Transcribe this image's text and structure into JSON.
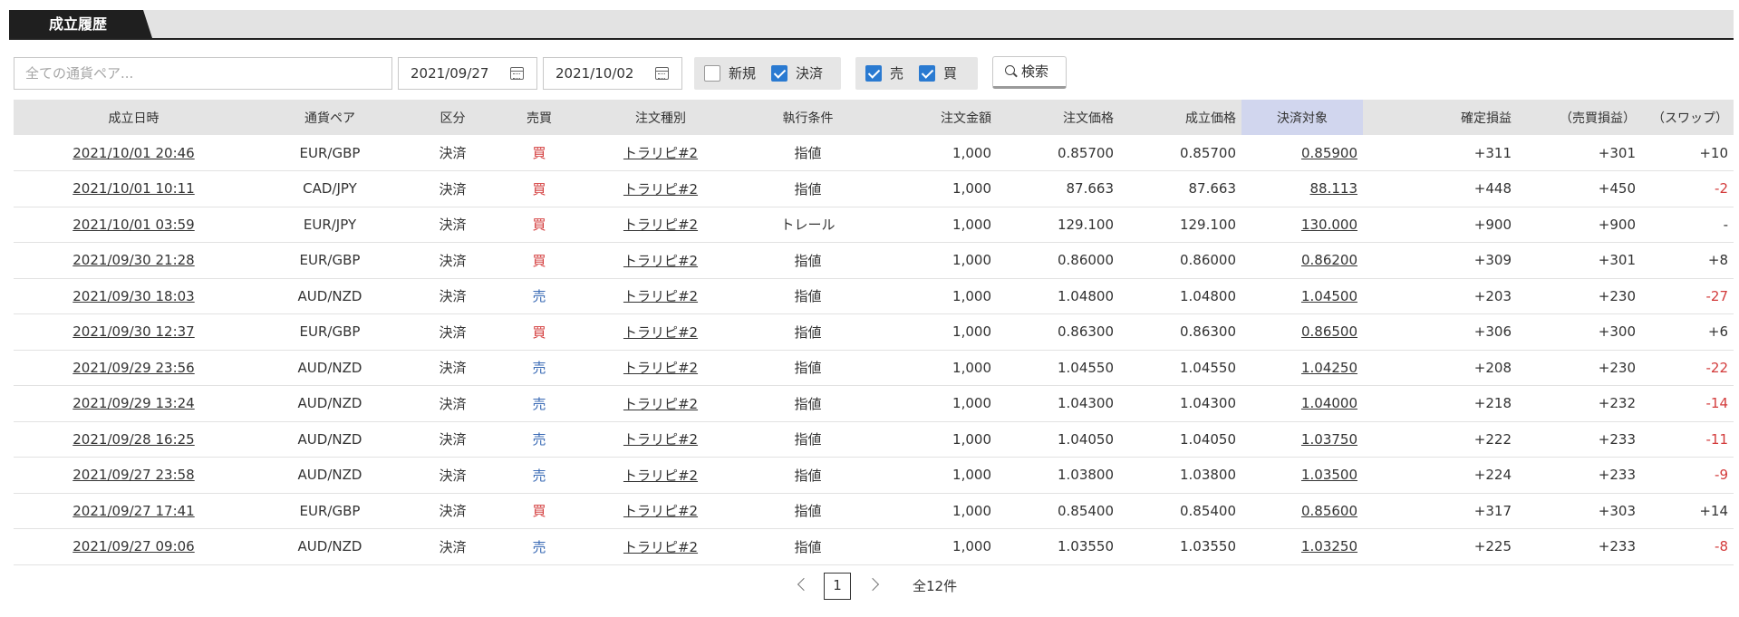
{
  "header": {
    "tab_label": "成立履歴"
  },
  "filters": {
    "pair_placeholder": "全ての通貨ペア...",
    "date_from": "2021/09/27",
    "date_to": "2021/10/02",
    "chk_new": {
      "label": "新規",
      "checked": false
    },
    "chk_settle": {
      "label": "決済",
      "checked": true
    },
    "chk_sell": {
      "label": "売",
      "checked": true
    },
    "chk_buy": {
      "label": "買",
      "checked": true
    },
    "search_label": "検索",
    "icons": {
      "date": "calendar-icon",
      "search": "search-icon"
    }
  },
  "table": {
    "columns": [
      "成立日時",
      "通貨ペア",
      "区分",
      "売買",
      "注文種別",
      "執行条件",
      "注文金額",
      "注文価格",
      "成立価格",
      "決済対象",
      "確定損益",
      "（売買損益）",
      "（スワップ）"
    ],
    "rows": [
      [
        "2021/10/01 20:46",
        "EUR/GBP",
        "決済",
        "買",
        "トラリピ#2",
        "指値",
        "1,000",
        "0.85700",
        "0.85700",
        "0.85900",
        "+311",
        "+301",
        "+10"
      ],
      [
        "2021/10/01 10:11",
        "CAD/JPY",
        "決済",
        "買",
        "トラリピ#2",
        "指値",
        "1,000",
        "87.663",
        "87.663",
        "88.113",
        "+448",
        "+450",
        "-2"
      ],
      [
        "2021/10/01 03:59",
        "EUR/JPY",
        "決済",
        "買",
        "トラリピ#2",
        "トレール",
        "1,000",
        "129.100",
        "129.100",
        "130.000",
        "+900",
        "+900",
        "-"
      ],
      [
        "2021/09/30 21:28",
        "EUR/GBP",
        "決済",
        "買",
        "トラリピ#2",
        "指値",
        "1,000",
        "0.86000",
        "0.86000",
        "0.86200",
        "+309",
        "+301",
        "+8"
      ],
      [
        "2021/09/30 18:03",
        "AUD/NZD",
        "決済",
        "売",
        "トラリピ#2",
        "指値",
        "1,000",
        "1.04800",
        "1.04800",
        "1.04500",
        "+203",
        "+230",
        "-27"
      ],
      [
        "2021/09/30 12:37",
        "EUR/GBP",
        "決済",
        "買",
        "トラリピ#2",
        "指値",
        "1,000",
        "0.86300",
        "0.86300",
        "0.86500",
        "+306",
        "+300",
        "+6"
      ],
      [
        "2021/09/29 23:56",
        "AUD/NZD",
        "決済",
        "売",
        "トラリピ#2",
        "指値",
        "1,000",
        "1.04550",
        "1.04550",
        "1.04250",
        "+208",
        "+230",
        "-22"
      ],
      [
        "2021/09/29 13:24",
        "AUD/NZD",
        "決済",
        "売",
        "トラリピ#2",
        "指値",
        "1,000",
        "1.04300",
        "1.04300",
        "1.04000",
        "+218",
        "+232",
        "-14"
      ],
      [
        "2021/09/28 16:25",
        "AUD/NZD",
        "決済",
        "売",
        "トラリピ#2",
        "指値",
        "1,000",
        "1.04050",
        "1.04050",
        "1.03750",
        "+222",
        "+233",
        "-11"
      ],
      [
        "2021/09/27 23:58",
        "AUD/NZD",
        "決済",
        "売",
        "トラリピ#2",
        "指値",
        "1,000",
        "1.03800",
        "1.03800",
        "1.03500",
        "+224",
        "+233",
        "-9"
      ],
      [
        "2021/09/27 17:41",
        "EUR/GBP",
        "決済",
        "買",
        "トラリピ#2",
        "指値",
        "1,000",
        "0.85400",
        "0.85400",
        "0.85600",
        "+317",
        "+303",
        "+14"
      ],
      [
        "2021/09/27 09:06",
        "AUD/NZD",
        "決済",
        "売",
        "トラリピ#2",
        "指値",
        "1,000",
        "1.03550",
        "1.03550",
        "1.03250",
        "+225",
        "+233",
        "-8"
      ]
    ]
  },
  "colors": {
    "buy": "#d33b3b",
    "sell": "#3b6bb5",
    "negative": "#d33b3b",
    "highlight_header": "#d1d6ee",
    "checkbox_on": "#2a7ad1"
  },
  "pagination": {
    "current": "1",
    "total_label": "全12件"
  }
}
